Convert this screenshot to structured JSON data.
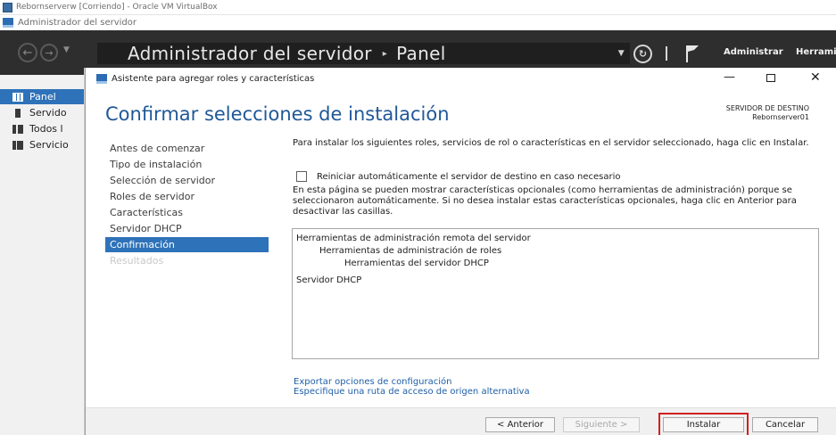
{
  "vbox": {
    "title": "Rebornserverw [Corriendo] - Oracle VM VirtualBox"
  },
  "server_manager": {
    "title": "Administrador del servidor",
    "breadcrumb": {
      "app": "Administrador del servidor",
      "page": "Panel"
    },
    "menu": {
      "administrar": "Administrar",
      "herramientas": "Herrami"
    },
    "sidebar": [
      {
        "label": "Panel",
        "icon": "dashboard-icon",
        "active": true
      },
      {
        "label": "Servido",
        "icon": "server-icon"
      },
      {
        "label": "Todos l",
        "icon": "servers-icon"
      },
      {
        "label": "Servicio",
        "icon": "file-services-icon"
      }
    ]
  },
  "wizard": {
    "title": "Asistente para agregar roles y características",
    "heading": "Confirmar selecciones de instalación",
    "destination_label": "SERVIDOR DE DESTINO",
    "destination_server": "Rebornserver01",
    "steps": [
      {
        "label": "Antes de comenzar",
        "state": "normal"
      },
      {
        "label": "Tipo de instalación",
        "state": "normal"
      },
      {
        "label": "Selección de servidor",
        "state": "normal"
      },
      {
        "label": "Roles de servidor",
        "state": "normal"
      },
      {
        "label": "Características",
        "state": "normal"
      },
      {
        "label": "Servidor DHCP",
        "state": "normal"
      },
      {
        "label": "Confirmación",
        "state": "current"
      },
      {
        "label": "Resultados",
        "state": "disabled"
      }
    ],
    "intro": "Para instalar los siguientes roles, servicios de rol o características en el servidor seleccionado, haga clic en Instalar.",
    "restart_checkbox": {
      "label": "Reiniciar automáticamente el servidor de destino en caso necesario",
      "checked": false
    },
    "optional_text": "En esta página se pueden mostrar características opcionales (como herramientas de administración) porque se seleccionaron automáticamente. Si no desea instalar estas características opcionales, haga clic en Anterior para desactivar las casillas.",
    "selections": [
      {
        "text": "Herramientas de administración remota del servidor",
        "level": 0
      },
      {
        "text": "Herramientas de administración de roles",
        "level": 1
      },
      {
        "text": "Herramientas del servidor DHCP",
        "level": 2
      },
      {
        "text": "Servidor DHCP",
        "level": 0
      }
    ],
    "links": {
      "export": "Exportar opciones de configuración",
      "alt_source": "Especifique una ruta de acceso de origen alternativa"
    },
    "buttons": {
      "previous": "< Anterior",
      "next": "Siguiente >",
      "install": "Instalar",
      "cancel": "Cancelar"
    },
    "highlight_color": "#d21f1f",
    "accent_color": "#2e72b9"
  }
}
